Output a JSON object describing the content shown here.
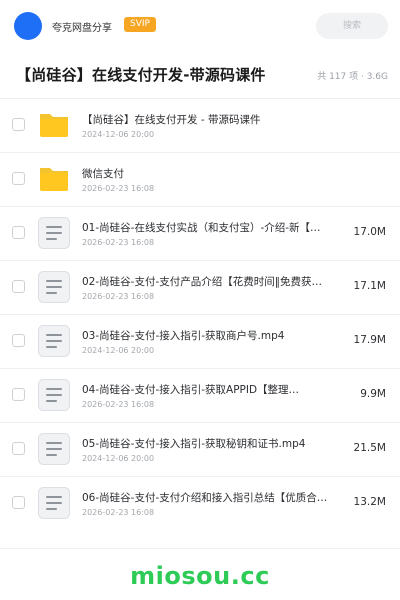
{
  "header": {
    "user_name": "夸克网盘分享",
    "badge": "SVIP",
    "search_placeholder": "搜索",
    "avatar_color": "#1e6ff5",
    "badge_color": "#f6a623"
  },
  "folder": {
    "title": "【尚硅谷】在线支付开发-带源码课件",
    "meta": "共 117 项 · 3.6G"
  },
  "items": [
    {
      "type": "folder-icon",
      "name": "【尚硅谷】在线支付开发 - 带源码课件",
      "date": "2024-12-06 20:00",
      "size": ""
    },
    {
      "type": "folder-icon",
      "name": "微信支付",
      "date": "2026-02-23 16:08",
      "size": ""
    },
    {
      "type": "document-icon",
      "name": "01-尚硅谷-在线支付实战（和支付宝）-介绍-新【…",
      "date": "2026-02-23 16:08",
      "size": "17.0M"
    },
    {
      "type": "document-icon",
      "name": "02-尚硅谷-支付-支付产品介绍【花费时间‖免费获…",
      "date": "2026-02-23 16:08",
      "size": "17.1M"
    },
    {
      "type": "document-icon",
      "name": "03-尚硅谷-支付-接入指引-获取商户号.mp4",
      "date": "2024-12-06 20:00",
      "size": "17.9M"
    },
    {
      "type": "document-icon",
      "name": "04-尚硅谷-支付-接入指引-获取APPID【整理…",
      "date": "2026-02-23 16:08",
      "size": "9.9M"
    },
    {
      "type": "document-icon",
      "name": "05-尚硅谷-支付-接入指引-获取秘钥和证书.mp4",
      "date": "2024-12-06 20:00",
      "size": "21.5M"
    },
    {
      "type": "document-icon",
      "name": "06-尚硅谷-支付-支付介绍和接入指引总结【优质合…",
      "date": "2026-02-23 16:08",
      "size": "13.2M"
    }
  ],
  "watermark": "miosou.cc",
  "watermark_color": "#2ecb57"
}
